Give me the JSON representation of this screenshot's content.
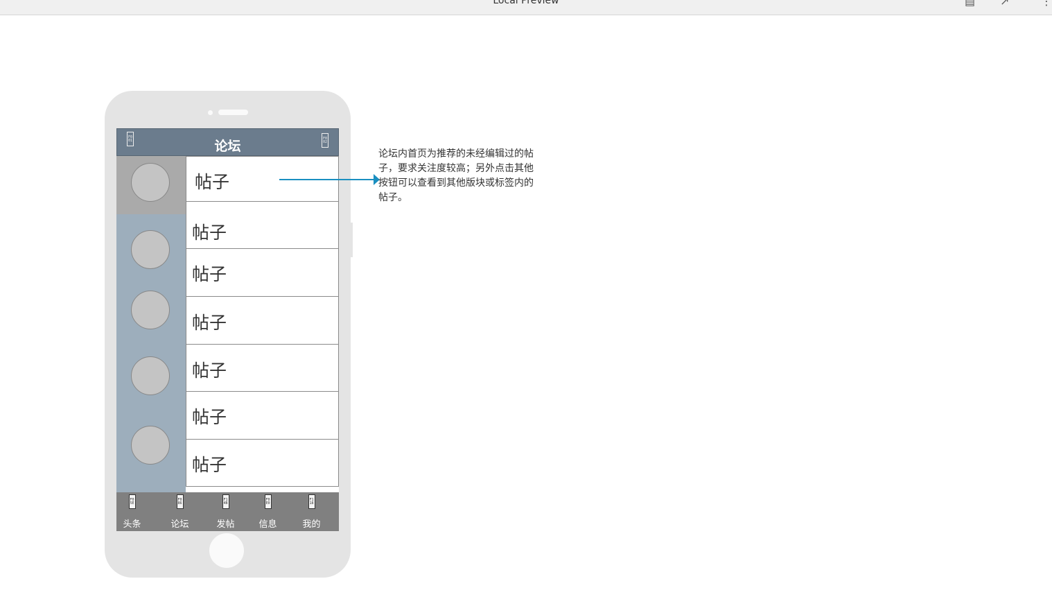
{
  "window": {
    "title": "Local Preview"
  },
  "header": {
    "title": "论坛",
    "left_icon": "F0 01",
    "right_icon": "F0 02"
  },
  "posts": [
    {
      "label": "帖子"
    },
    {
      "label": "帖子"
    },
    {
      "label": "帖子"
    },
    {
      "label": "帖子"
    },
    {
      "label": "帖子"
    },
    {
      "label": "帖子"
    },
    {
      "label": "帖子"
    }
  ],
  "tabbar": [
    {
      "label": "头条",
      "icon": "F0 5E"
    },
    {
      "label": "论坛",
      "icon": "F0 86"
    },
    {
      "label": "发帖",
      "icon": "F1 4B"
    },
    {
      "label": "信息",
      "icon": "F0 E0"
    },
    {
      "label": "我的",
      "icon": "F1 18"
    }
  ],
  "annotation": {
    "text": "论坛内首页为推荐的未经编辑过的帖子，要求关注度较高；另外点击其他按钮可以查看到其他版块或标签内的帖子。"
  },
  "colors": {
    "header": "#6b7c8d",
    "sidebar": "#9daebc",
    "sidebar_selected": "#aaaaaa",
    "tabbar": "#808080",
    "connector": "#1a8fc0",
    "phone_body": "#e4e4e4"
  }
}
